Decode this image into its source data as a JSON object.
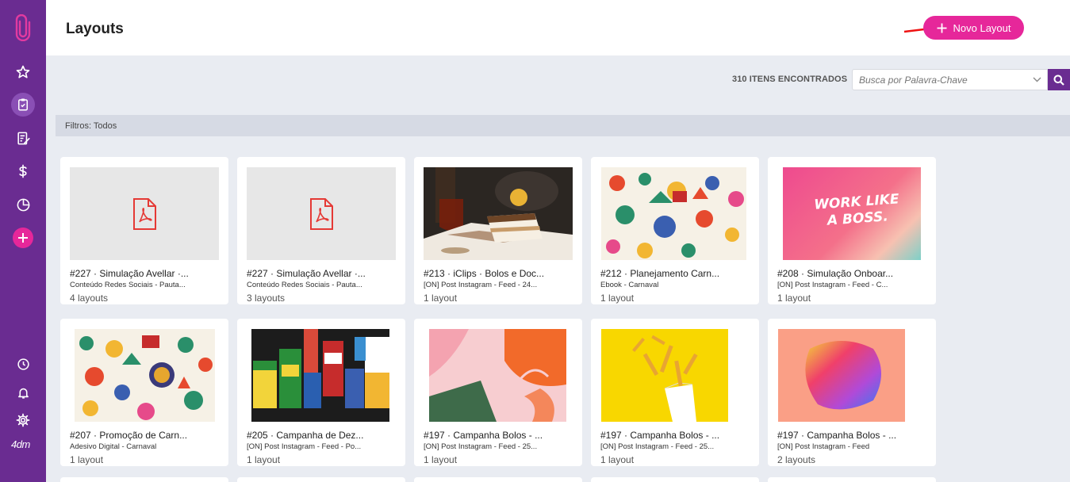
{
  "header": {
    "title": "Layouts",
    "new_button_label": "Novo Layout"
  },
  "toolbar": {
    "count_text": "310 ITENS ENCONTRADOS",
    "search_placeholder": "Busca por Palavra-Chave"
  },
  "filters": {
    "text": "Filtros: Todos"
  },
  "sidebar": {
    "user_label": "4dm"
  },
  "cards": [
    {
      "title": "#227 · Simulação Avellar ·...",
      "subtitle": "Conteúdo Redes Sociais - Pauta...",
      "count": "4 layouts",
      "thumb": "pdf"
    },
    {
      "title": "#227 · Simulação Avellar ·...",
      "subtitle": "Conteúdo Redes Sociais - Pauta...",
      "count": "3 layouts",
      "thumb": "pdf"
    },
    {
      "title": "#213 · iClips · Bolos e Doc...",
      "subtitle": "[ON] Post Instagram - Feed - 24...",
      "count": "1 layout",
      "thumb": "cake"
    },
    {
      "title": "#212 · Planejamento Carn...",
      "subtitle": "Ebook - Carnaval",
      "count": "1 layout",
      "thumb": "carnival"
    },
    {
      "title": "#208 · Simulação Onboar...",
      "subtitle": "[ON] Post Instagram - Feed - C...",
      "count": "1 layout",
      "thumb": "boss",
      "thumb_text_1": "WORK LIKE",
      "thumb_text_2": "A BOSS."
    },
    {
      "title": "#207 · Promoção de Carn...",
      "subtitle": "Adesivo Digital - Carnaval",
      "count": "1 layout",
      "thumb": "carnival2"
    },
    {
      "title": "#205 · Campanha de Dez...",
      "subtitle": "[ON] Post Instagram - Feed - Po...",
      "count": "1 layout",
      "thumb": "pharma"
    },
    {
      "title": "#197 · Campanha Bolos - ...",
      "subtitle": "[ON] Post Instagram - Feed - 25...",
      "count": "1 layout",
      "thumb": "abstract"
    },
    {
      "title": "#197 · Campanha Bolos - ...",
      "subtitle": "[ON] Post Instagram - Feed - 25...",
      "count": "1 layout",
      "thumb": "fries"
    },
    {
      "title": "#197 · Campanha Bolos - ...",
      "subtitle": "[ON] Post Instagram - Feed",
      "count": "2 layouts",
      "thumb": "blob"
    }
  ]
}
